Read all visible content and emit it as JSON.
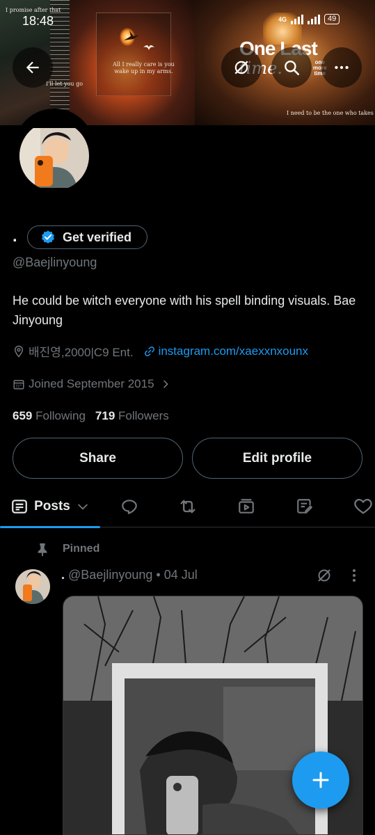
{
  "status_bar": {
    "time": "18:48",
    "network": "4G",
    "battery": "49"
  },
  "banner": {
    "text_top_left": "I promise after that",
    "text_left_mid": "I'll let you go",
    "text_center": "All I really care is you\nwake up in my arms.",
    "title": "One Last",
    "title_script": "time.",
    "small_text": "one\nmore\ntime",
    "caption": "I need to be the one who takes you home."
  },
  "profile": {
    "display_name": ".",
    "verify_label": "Get verified",
    "handle": "@Baejlinyoung",
    "bio": "He could be witch everyone with his spell binding visuals. Bae Jinyoung",
    "location": "배진영,2000|C9 Ent.",
    "link": "instagram.com/xaexxnxounx",
    "joined": "Joined September 2015",
    "following_count": "659",
    "following_label": "Following",
    "followers_count": "719",
    "followers_label": "Followers"
  },
  "actions": {
    "share": "Share",
    "edit_profile": "Edit profile"
  },
  "tabs": {
    "posts_label": "Posts"
  },
  "post": {
    "pinned_label": "Pinned",
    "author_name": ".",
    "author_handle": "@Baejlinyoung",
    "separator": "•",
    "date": "04 Jul"
  },
  "colors": {
    "accent": "#1d9bf0",
    "muted": "#71767b",
    "text": "#e7e9ea",
    "border": "#536471"
  }
}
